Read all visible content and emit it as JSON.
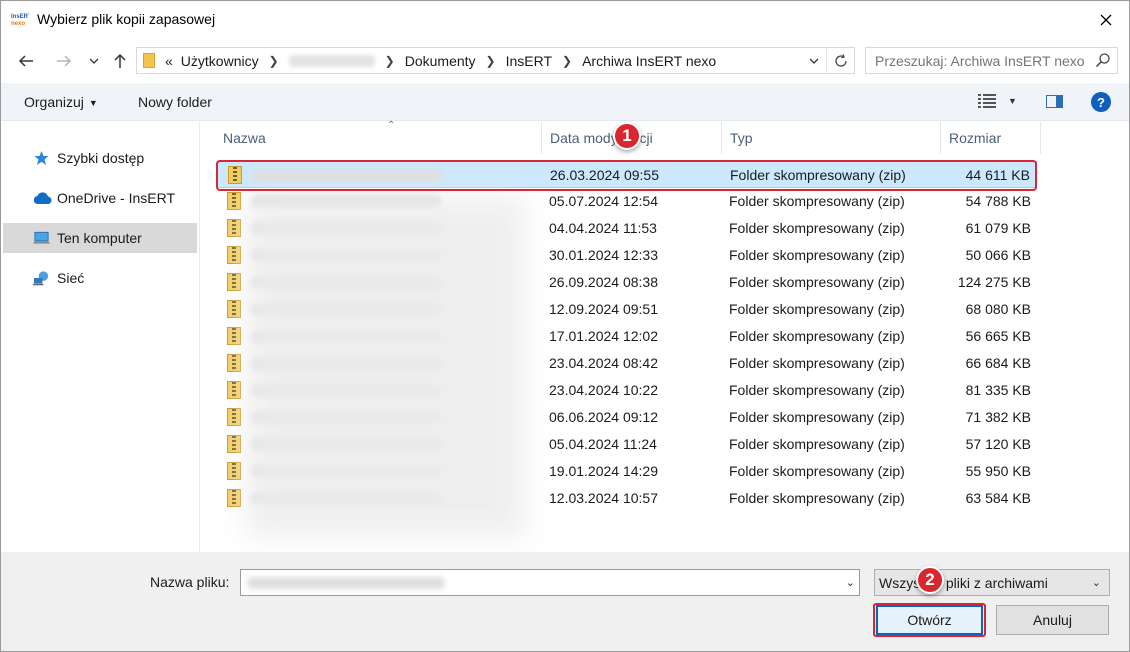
{
  "window": {
    "title": "Wybierz plik kopii zapasowej",
    "logo_text_top": "InsERT",
    "logo_text_bottom": "nexo"
  },
  "address": {
    "overflow": "«",
    "crumbs": [
      "Użytkownicy",
      "Dokumenty",
      "InsERT",
      "Archiwa InsERT nexo"
    ]
  },
  "search": {
    "placeholder": "Przeszukaj: Archiwa InsERT nexo"
  },
  "toolbar": {
    "organize": "Organizuj",
    "new_folder": "Nowy folder"
  },
  "nav": {
    "items": [
      {
        "label": "Szybki dostęp",
        "icon": "star-icon"
      },
      {
        "label": "OneDrive - InsERT",
        "icon": "cloud-icon"
      },
      {
        "label": "Ten komputer",
        "icon": "computer-icon",
        "selected": true
      },
      {
        "label": "Sieć",
        "icon": "network-icon"
      }
    ]
  },
  "columns": {
    "name": "Nazwa",
    "date": "Data modyfikacji",
    "type": "Typ",
    "size": "Rozmiar"
  },
  "files": [
    {
      "date": "26.03.2024 09:55",
      "type": "Folder skompresowany (zip)",
      "size": "44 611 KB",
      "selected": true
    },
    {
      "date": "05.07.2024 12:54",
      "type": "Folder skompresowany (zip)",
      "size": "54 788 KB"
    },
    {
      "date": "04.04.2024 11:53",
      "type": "Folder skompresowany (zip)",
      "size": "61 079 KB"
    },
    {
      "date": "30.01.2024 12:33",
      "type": "Folder skompresowany (zip)",
      "size": "50 066 KB"
    },
    {
      "date": "26.09.2024 08:38",
      "type": "Folder skompresowany (zip)",
      "size": "124 275 KB"
    },
    {
      "date": "12.09.2024 09:51",
      "type": "Folder skompresowany (zip)",
      "size": "68 080 KB"
    },
    {
      "date": "17.01.2024 12:02",
      "type": "Folder skompresowany (zip)",
      "size": "56 665 KB"
    },
    {
      "date": "23.04.2024 08:42",
      "type": "Folder skompresowany (zip)",
      "size": "66 684 KB"
    },
    {
      "date": "23.04.2024 10:22",
      "type": "Folder skompresowany (zip)",
      "size": "81 335 KB"
    },
    {
      "date": "06.06.2024 09:12",
      "type": "Folder skompresowany (zip)",
      "size": "71 382 KB"
    },
    {
      "date": "05.04.2024 11:24",
      "type": "Folder skompresowany (zip)",
      "size": "57 120 KB"
    },
    {
      "date": "19.01.2024 14:29",
      "type": "Folder skompresowany (zip)",
      "size": "55 950 KB"
    },
    {
      "date": "12.03.2024 10:57",
      "type": "Folder skompresowany (zip)",
      "size": "63 584 KB"
    }
  ],
  "bottom": {
    "filename_label": "Nazwa pliku:",
    "filter_value": "Wszystkie pliki z archiwami",
    "open_button": "Otwórz",
    "cancel_button": "Anuluj"
  },
  "annotations": {
    "step1": "1",
    "step2": "2",
    "color": "#d9262f"
  },
  "colors": {
    "selection": "#cce8ff",
    "accent": "#0a64c6",
    "command_bar": "#f0f4f9"
  }
}
